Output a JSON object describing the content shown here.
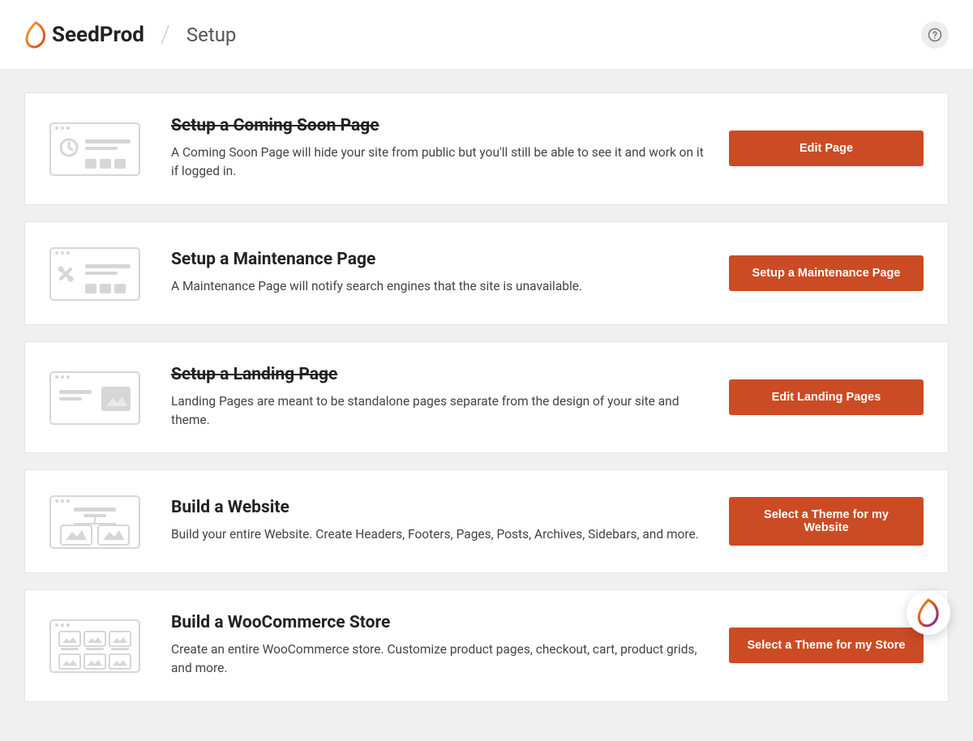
{
  "header": {
    "brand": "SeedProd",
    "page_title": "Setup"
  },
  "cards": [
    {
      "title": "Setup a Coming Soon Page",
      "completed": true,
      "desc": "A Coming Soon Page will hide your site from public but you'll still be able to see it and work on it if logged in.",
      "button": "Edit Page"
    },
    {
      "title": "Setup a Maintenance Page",
      "completed": false,
      "desc": "A Maintenance Page will notify search engines that the site is unavailable.",
      "button": "Setup a Maintenance Page"
    },
    {
      "title": "Setup a Landing Page",
      "completed": true,
      "desc": "Landing Pages are meant to be standalone pages separate from the design of your site and theme.",
      "button": "Edit Landing Pages"
    },
    {
      "title": "Build a Website",
      "completed": false,
      "desc": "Build your entire Website. Create Headers, Footers, Pages, Posts, Archives, Sidebars, and more.",
      "button": "Select a Theme for my Website"
    },
    {
      "title": "Build a WooCommerce Store",
      "completed": false,
      "desc": "Create an entire WooCommerce store. Customize product pages, checkout, cart, product grids, and more.",
      "button": "Select a Theme for my Store"
    }
  ]
}
